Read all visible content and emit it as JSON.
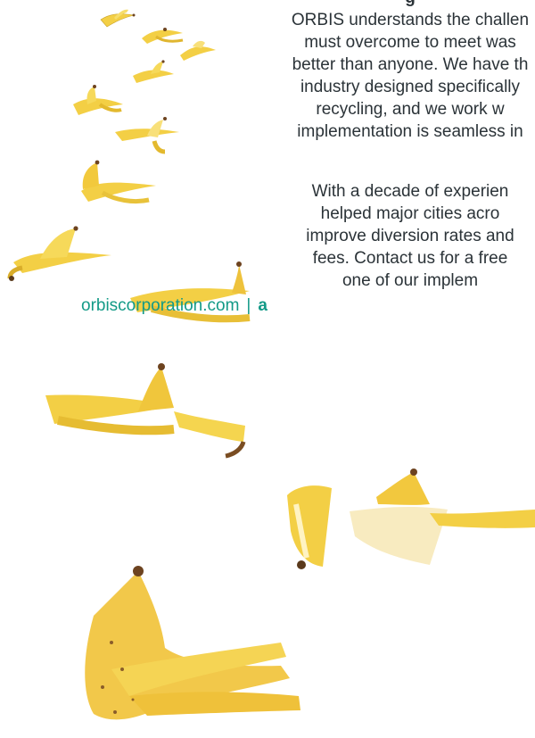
{
  "heading_partial": "g",
  "paragraph1": [
    "ORBIS understands the challen",
    "must overcome to meet was",
    "better than anyone. We have th",
    "industry designed specifically",
    "recycling,  and we work w",
    "implementation is seamless in"
  ],
  "paragraph2": [
    "With a decade of experien",
    "helped major cities acro",
    "improve diversion rates and",
    "fees. Contact us for a free",
    "one of our implem"
  ],
  "footer": {
    "website": "orbiscorporation.com",
    "separator": "|",
    "second_partial": "a"
  },
  "colors": {
    "text": "#2b3338",
    "accent": "#139a87",
    "banana": "#f3cf45"
  },
  "illustration": "banana-peels"
}
